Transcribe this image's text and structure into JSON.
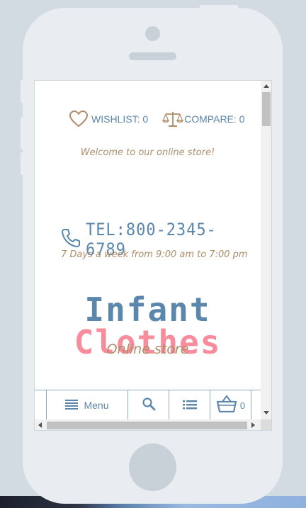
{
  "header": {
    "wishlist_label": "WISHLIST: 0",
    "compare_label": "COMPARE: 0"
  },
  "welcome_text": "Welcome to our online store!",
  "contact": {
    "phone": "TEL:800-2345-6789",
    "hours": "7 Days a week from 9:00 am to 7:00 pm"
  },
  "logo": {
    "word1": "Infant",
    "word2": "Clothes",
    "tagline": "Online store"
  },
  "nav": {
    "menu_label": "Menu",
    "cart_count": "0"
  },
  "colors": {
    "accent_blue": "#5b87ad",
    "accent_pink": "#f88c9c",
    "accent_tan": "#b08d69"
  },
  "icons": [
    "heart-icon",
    "scales-icon",
    "phone-icon",
    "hamburger-icon",
    "search-icon",
    "list-icon",
    "basket-icon"
  ]
}
